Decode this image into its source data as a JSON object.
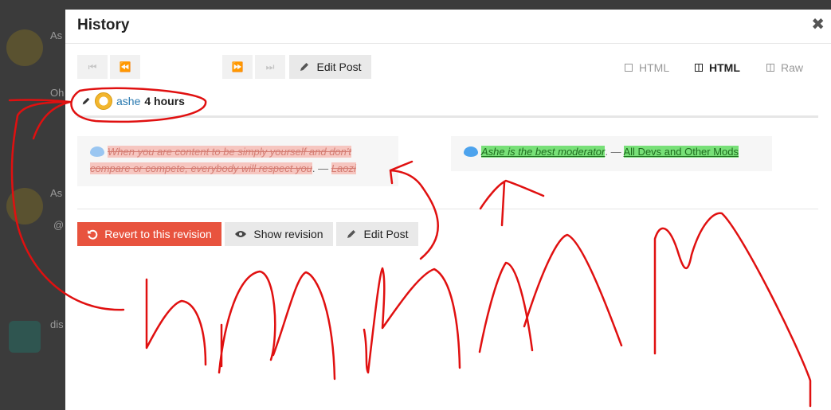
{
  "modal": {
    "title": "History",
    "close_label": "✖"
  },
  "toolbar": {
    "first_label": "⏮",
    "prev_label": "⏪",
    "next_label": "⏩",
    "last_label": "⏭",
    "edit_label": "Edit Post"
  },
  "view_modes": [
    {
      "label": "HTML",
      "active": false
    },
    {
      "label": "HTML",
      "active": true
    },
    {
      "label": "Raw",
      "active": false
    }
  ],
  "revision": {
    "user": "ashe",
    "age": "4 hours"
  },
  "diff": {
    "removed": {
      "text": "When you are content to be simply yourself and don't compare or compete, everybody will respect you",
      "dash": ". —",
      "author": "Laozi"
    },
    "added": {
      "text": "Ashe is the best moderator",
      "dash": ". —",
      "author": "All Devs and Other Mods"
    }
  },
  "actions": {
    "revert_label": "Revert to this revision",
    "show_label": "Show revision",
    "edit_label": "Edit Post"
  },
  "background": {
    "name_a": "As",
    "name_b": "As",
    "text_oh": "Oh",
    "mention": "@",
    "name_c": "dis"
  },
  "colors": {
    "revert": "#e8533e",
    "annotation": "#e01010",
    "added_bg": "#78e078",
    "removed_bg": "#f6c6c0"
  }
}
